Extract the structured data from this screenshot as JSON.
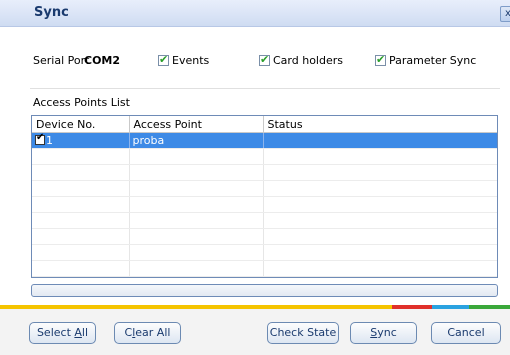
{
  "window": {
    "title": "Sync",
    "close_label": "x"
  },
  "serial": {
    "label": "Serial Port",
    "value": "COM2"
  },
  "options": [
    {
      "label": "Events",
      "checked": true
    },
    {
      "label": "Card holders",
      "checked": true
    },
    {
      "label": "Parameter Sync",
      "checked": true
    }
  ],
  "access_points": {
    "label": "Access Points List",
    "columns": [
      "Device No.",
      "Access Point",
      "Status"
    ],
    "rows": [
      {
        "checked": true,
        "device_no": "1",
        "access_point": "proba",
        "status": "",
        "selected": true
      }
    ],
    "empty_rows": 8
  },
  "progress": {
    "value": 0
  },
  "buttons": {
    "select_all": {
      "pre": "Select ",
      "ul": "A",
      "post": "ll"
    },
    "clear_all": {
      "pre": "C",
      "ul": "l",
      "post": "ear All"
    },
    "check_state": {
      "pre": "Check State",
      "ul": "",
      "post": ""
    },
    "sync": {
      "pre": "",
      "ul": "S",
      "post": "ync"
    },
    "cancel": {
      "pre": "Cancel",
      "ul": "",
      "post": ""
    }
  },
  "colors": {
    "stripe": [
      "#f5c400",
      "#e0302a",
      "#2aa2e0",
      "#3aa83a"
    ],
    "selection": "#3d8ae6"
  }
}
